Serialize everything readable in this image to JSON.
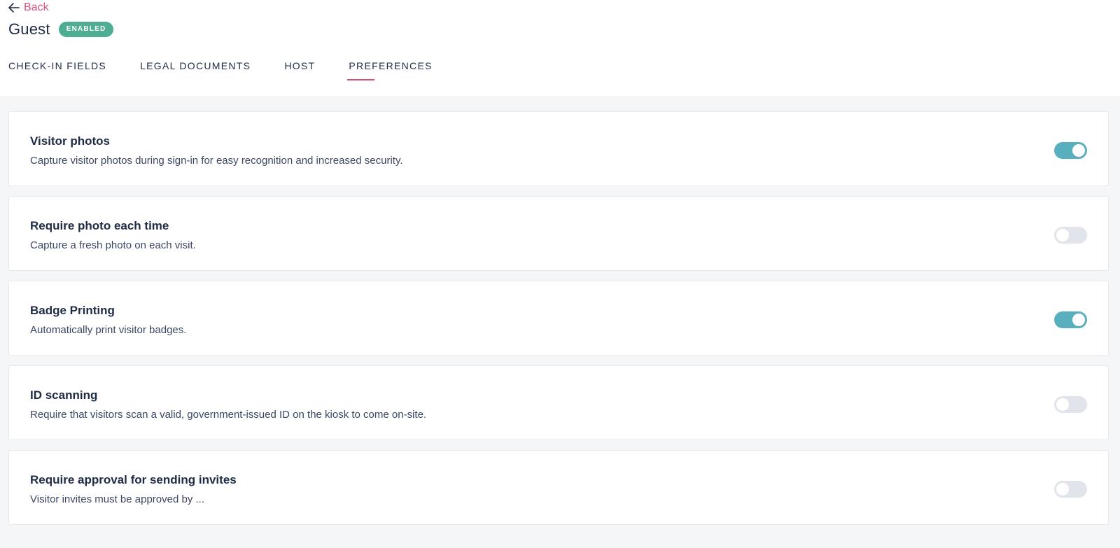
{
  "nav": {
    "back_label": "Back"
  },
  "header": {
    "title": "Guest",
    "status_badge": "ENABLED",
    "accent_color": "#d9507f",
    "badge_color": "#4fad94"
  },
  "tabs": [
    {
      "label": "CHECK-IN FIELDS",
      "active": false
    },
    {
      "label": "LEGAL DOCUMENTS",
      "active": false
    },
    {
      "label": "HOST",
      "active": false
    },
    {
      "label": "PREFERENCES",
      "active": true
    }
  ],
  "preferences": [
    {
      "title": "Visitor photos",
      "description": "Capture visitor photos during sign-in for easy recognition and increased security.",
      "enabled": true
    },
    {
      "title": "Require photo each time",
      "description": "Capture a fresh photo on each visit.",
      "enabled": false
    },
    {
      "title": "Badge Printing",
      "description": "Automatically print visitor badges.",
      "enabled": true
    },
    {
      "title": "ID scanning",
      "description": "Require that visitors scan a valid, government-issued ID on the kiosk to come on-site.",
      "enabled": false
    },
    {
      "title": "Require approval for sending invites",
      "description": "Visitor invites must be approved by ...",
      "enabled": false
    }
  ],
  "toggle_colors": {
    "on": "#5aafbf",
    "off": "#e1e4ea"
  }
}
